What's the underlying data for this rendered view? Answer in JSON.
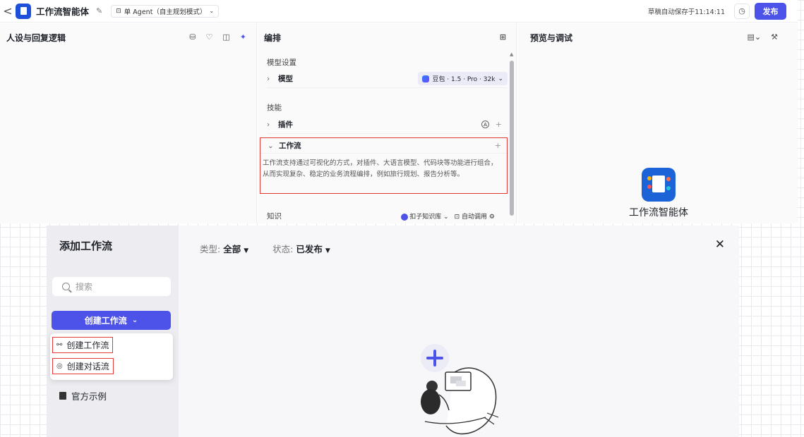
{
  "topbar": {
    "back": "<",
    "app_title": "工作流智能体",
    "mode": "单 Agent（自主规划模式）",
    "save_status": "草稿自动保存于11:14:11",
    "publish": "发布"
  },
  "left_panel": {
    "title": "人设与回复逻辑"
  },
  "mid_panel": {
    "title": "编排",
    "model_section": "模型设置",
    "model_row": "模型",
    "model_value": "豆包 · 1.5 · Pro · 32k",
    "skills_section": "技能",
    "plugin_row": "插件",
    "workflow_row": "工作流",
    "workflow_desc": "工作流支持通过可视化的方式，对插件、大语言模型、代码块等功能进行组合，从而实现复杂、稳定的业务流程编排，例如旅行规划、报告分析等。",
    "knowledge_section": "知识",
    "kb_value": "扣子知识库",
    "auto_call": "自动调用"
  },
  "right_panel": {
    "title": "预览与调试",
    "agent_name": "工作流智能体"
  },
  "modal": {
    "title": "添加工作流",
    "search_placeholder": "搜索",
    "create_button": "创建工作流",
    "dropdown": [
      "创建工作流",
      "创建对话流"
    ],
    "official_examples": "官方示例",
    "filter_type_label": "类型:",
    "filter_type_value": "全部",
    "filter_status_label": "状态:",
    "filter_status_value": "已发布"
  },
  "colors": {
    "accent": "#4d53e8",
    "highlight": "#e53935"
  }
}
